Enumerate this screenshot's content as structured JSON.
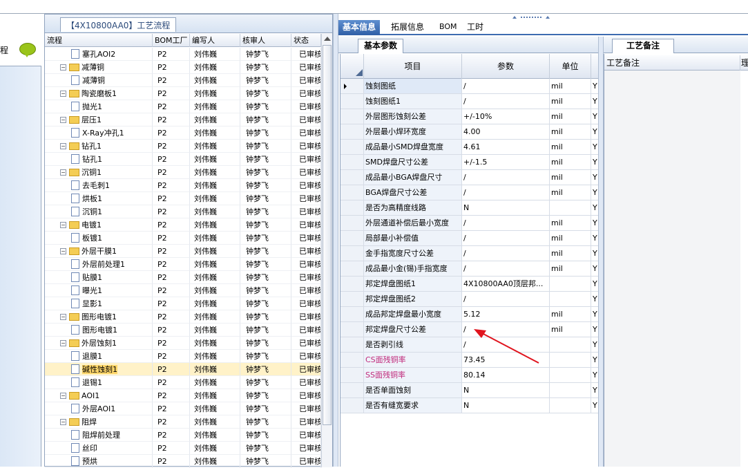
{
  "left_panel": {
    "label": "程"
  },
  "tree_panel": {
    "tab_title": "【4X10800AA0】工艺流程",
    "columns": [
      "流程",
      "BOM工厂",
      "编写人",
      "核审人",
      "状态"
    ],
    "rows": [
      {
        "type": "leaf",
        "level": 1,
        "name": "塞孔AOI2",
        "bom": "P2",
        "writer": "刘伟巍",
        "reviewer": "钟梦飞",
        "status": "已审核"
      },
      {
        "type": "group",
        "level": 0,
        "name": "减薄铜",
        "bom": "P2",
        "writer": "刘伟巍",
        "reviewer": "钟梦飞",
        "status": "已审核"
      },
      {
        "type": "leaf",
        "level": 1,
        "name": "减薄铜",
        "bom": "P2",
        "writer": "刘伟巍",
        "reviewer": "钟梦飞",
        "status": "已审核"
      },
      {
        "type": "group",
        "level": 0,
        "name": "陶瓷磨板1",
        "bom": "P2",
        "writer": "刘伟巍",
        "reviewer": "钟梦飞",
        "status": "已审核"
      },
      {
        "type": "leaf",
        "level": 1,
        "name": "抛光1",
        "bom": "P2",
        "writer": "刘伟巍",
        "reviewer": "钟梦飞",
        "status": "已审核"
      },
      {
        "type": "group",
        "level": 0,
        "name": "层压1",
        "bom": "P2",
        "writer": "刘伟巍",
        "reviewer": "钟梦飞",
        "status": "已审核"
      },
      {
        "type": "leaf",
        "level": 1,
        "name": "X-Ray冲孔1",
        "bom": "P2",
        "writer": "刘伟巍",
        "reviewer": "钟梦飞",
        "status": "已审核"
      },
      {
        "type": "group",
        "level": 0,
        "name": "钻孔1",
        "bom": "P2",
        "writer": "刘伟巍",
        "reviewer": "钟梦飞",
        "status": "已审核"
      },
      {
        "type": "leaf",
        "level": 1,
        "name": "钻孔1",
        "bom": "P2",
        "writer": "刘伟巍",
        "reviewer": "钟梦飞",
        "status": "已审核"
      },
      {
        "type": "group",
        "level": 0,
        "name": "沉铜1",
        "bom": "P2",
        "writer": "刘伟巍",
        "reviewer": "钟梦飞",
        "status": "已审核"
      },
      {
        "type": "leaf",
        "level": 1,
        "name": "去毛刺1",
        "bom": "P2",
        "writer": "刘伟巍",
        "reviewer": "钟梦飞",
        "status": "已审核"
      },
      {
        "type": "leaf",
        "level": 1,
        "name": "烘板1",
        "bom": "P2",
        "writer": "刘伟巍",
        "reviewer": "钟梦飞",
        "status": "已审核"
      },
      {
        "type": "leaf",
        "level": 1,
        "name": "沉铜1",
        "bom": "P2",
        "writer": "刘伟巍",
        "reviewer": "钟梦飞",
        "status": "已审核"
      },
      {
        "type": "group",
        "level": 0,
        "name": "电镀1",
        "bom": "P2",
        "writer": "刘伟巍",
        "reviewer": "钟梦飞",
        "status": "已审核"
      },
      {
        "type": "leaf",
        "level": 1,
        "name": "板镀1",
        "bom": "P2",
        "writer": "刘伟巍",
        "reviewer": "钟梦飞",
        "status": "已审核"
      },
      {
        "type": "group",
        "level": 0,
        "name": "外层干膜1",
        "bom": "P2",
        "writer": "刘伟巍",
        "reviewer": "钟梦飞",
        "status": "已审核"
      },
      {
        "type": "leaf",
        "level": 1,
        "name": "外层前处理1",
        "bom": "P2",
        "writer": "刘伟巍",
        "reviewer": "钟梦飞",
        "status": "已审核"
      },
      {
        "type": "leaf",
        "level": 1,
        "name": "贴膜1",
        "bom": "P2",
        "writer": "刘伟巍",
        "reviewer": "钟梦飞",
        "status": "已审核"
      },
      {
        "type": "leaf",
        "level": 1,
        "name": "曝光1",
        "bom": "P2",
        "writer": "刘伟巍",
        "reviewer": "钟梦飞",
        "status": "已审核"
      },
      {
        "type": "leaf",
        "level": 1,
        "name": "显影1",
        "bom": "P2",
        "writer": "刘伟巍",
        "reviewer": "钟梦飞",
        "status": "已审核"
      },
      {
        "type": "group",
        "level": 0,
        "name": "图形电镀1",
        "bom": "P2",
        "writer": "刘伟巍",
        "reviewer": "钟梦飞",
        "status": "已审核"
      },
      {
        "type": "leaf",
        "level": 1,
        "name": "图形电镀1",
        "bom": "P2",
        "writer": "刘伟巍",
        "reviewer": "钟梦飞",
        "status": "已审核"
      },
      {
        "type": "group",
        "level": 0,
        "name": "外层蚀刻1",
        "bom": "P2",
        "writer": "刘伟巍",
        "reviewer": "钟梦飞",
        "status": "已审核"
      },
      {
        "type": "leaf",
        "level": 1,
        "name": "退膜1",
        "bom": "P2",
        "writer": "刘伟巍",
        "reviewer": "钟梦飞",
        "status": "已审核"
      },
      {
        "type": "leaf",
        "level": 1,
        "name": "碱性蚀刻1",
        "bom": "P2",
        "writer": "刘伟巍",
        "reviewer": "钟梦飞",
        "status": "已审核",
        "selected": true
      },
      {
        "type": "leaf",
        "level": 1,
        "name": "退锡1",
        "bom": "P2",
        "writer": "刘伟巍",
        "reviewer": "钟梦飞",
        "status": "已审核"
      },
      {
        "type": "group",
        "level": 0,
        "name": "AOI1",
        "bom": "P2",
        "writer": "刘伟巍",
        "reviewer": "钟梦飞",
        "status": "已审核"
      },
      {
        "type": "leaf",
        "level": 1,
        "name": "外层AOI1",
        "bom": "P2",
        "writer": "刘伟巍",
        "reviewer": "钟梦飞",
        "status": "已审核"
      },
      {
        "type": "group",
        "level": 0,
        "name": "阻焊",
        "bom": "P2",
        "writer": "刘伟巍",
        "reviewer": "钟梦飞",
        "status": "已审核"
      },
      {
        "type": "leaf",
        "level": 1,
        "name": "阻焊前处理",
        "bom": "P2",
        "writer": "刘伟巍",
        "reviewer": "钟梦飞",
        "status": "已审核"
      },
      {
        "type": "leaf",
        "level": 1,
        "name": "丝印",
        "bom": "P2",
        "writer": "刘伟巍",
        "reviewer": "钟梦飞",
        "status": "已审核"
      },
      {
        "type": "leaf",
        "level": 1,
        "name": "预烘",
        "bom": "P2",
        "writer": "刘伟巍",
        "reviewer": "钟梦飞",
        "status": "已审核"
      }
    ]
  },
  "right_tabs": [
    "基本信息",
    "拓展信息",
    "BOM",
    "工时"
  ],
  "sub_tab": "基本参数",
  "params": {
    "columns": [
      "项目",
      "参数",
      "单位"
    ],
    "rows": [
      {
        "item": "蚀刻图纸",
        "value": "/",
        "unit": "mil",
        "flag": "Y"
      },
      {
        "item": "蚀刻图纸1",
        "value": "/",
        "unit": "mil",
        "flag": "Y"
      },
      {
        "item": "外层图形蚀刻公差",
        "value": "+/-10%",
        "unit": "mil",
        "flag": "Y"
      },
      {
        "item": "外层最小焊环宽度",
        "value": "4.00",
        "unit": "mil",
        "flag": "Y"
      },
      {
        "item": "成品最小SMD焊盘宽度",
        "value": "4.61",
        "unit": "mil",
        "flag": "Y"
      },
      {
        "item": "SMD焊盘尺寸公差",
        "value": "+/-1.5",
        "unit": "mil",
        "flag": "Y"
      },
      {
        "item": "成品最小BGA焊盘尺寸",
        "value": "/",
        "unit": "mil",
        "flag": "Y"
      },
      {
        "item": "BGA焊盘尺寸公差",
        "value": "/",
        "unit": "mil",
        "flag": "Y"
      },
      {
        "item": "是否为高精度线路",
        "value": "N",
        "unit": "",
        "flag": "Y"
      },
      {
        "item": "外层通道补偿后最小宽度",
        "value": "/",
        "unit": "mil",
        "flag": "Y"
      },
      {
        "item": "局部最小补偿值",
        "value": "/",
        "unit": "mil",
        "flag": "Y"
      },
      {
        "item": "金手指宽度尺寸公差",
        "value": "/",
        "unit": "mil",
        "flag": "Y"
      },
      {
        "item": "成品最小金(锡)手指宽度",
        "value": "/",
        "unit": "mil",
        "flag": "Y"
      },
      {
        "item": "邦定焊盘图纸1",
        "value": "4X10800AA0顶层邦...",
        "unit": "",
        "flag": "Y"
      },
      {
        "item": "邦定焊盘图纸2",
        "value": "/",
        "unit": "",
        "flag": "Y"
      },
      {
        "item": "成品邦定焊盘最小宽度",
        "value": "5.12",
        "unit": "mil",
        "flag": "Y"
      },
      {
        "item": "邦定焊盘尺寸公差",
        "value": "/",
        "unit": "mil",
        "flag": "Y"
      },
      {
        "item": "是否剥引线",
        "value": "/",
        "unit": "",
        "flag": "Y"
      },
      {
        "item": "CS面残铜率",
        "value": "73.45",
        "unit": "",
        "flag": "Y",
        "highlight": true
      },
      {
        "item": "SS面残铜率",
        "value": "80.14",
        "unit": "",
        "flag": "Y",
        "highlight": true
      },
      {
        "item": "是否单面蚀刻",
        "value": "N",
        "unit": "",
        "flag": "Y"
      },
      {
        "item": "是否有缝宽要求",
        "value": "N",
        "unit": "",
        "flag": "Y"
      }
    ]
  },
  "notes_panel": {
    "tab": "工艺备注",
    "column": "工艺备注",
    "extra_col": "理"
  },
  "colors": {
    "accent": "#2f5fa6",
    "selected_row": "#ffd76a",
    "highlight_text": "#c0287a",
    "annotation_arrow": "#e0141e"
  }
}
